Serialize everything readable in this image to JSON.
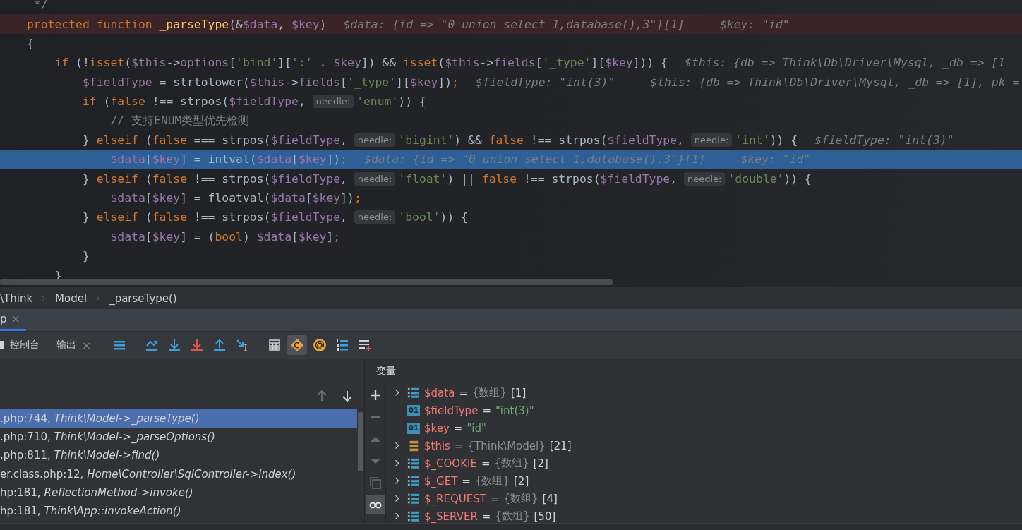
{
  "editor": {
    "lines": [
      {
        "kind": "normal",
        "tokens": [
          {
            "kind": "comment",
            "t": " */"
          }
        ]
      },
      {
        "kind": "breakpoint",
        "tokens": [
          {
            "kind": "kw",
            "t": "protected function "
          },
          {
            "kind": "fn",
            "t": "_parseType"
          },
          {
            "kind": "plain",
            "t": "(&"
          },
          {
            "kind": "var",
            "t": "$data"
          },
          {
            "kind": "plain",
            "t": ", "
          },
          {
            "kind": "var",
            "t": "$key"
          },
          {
            "kind": "plain",
            "t": ")"
          },
          {
            "kind": "inline",
            "t": "$data: {id => \"0 union select 1,database(),3\"}[1]"
          },
          {
            "kind": "inline",
            "t": "$key: \"id\""
          }
        ]
      },
      {
        "kind": "normal",
        "tokens": [
          {
            "kind": "plain",
            "t": "{"
          }
        ]
      },
      {
        "kind": "normal",
        "tokens": [
          {
            "kind": "kw",
            "t": "    if"
          },
          {
            "kind": "plain",
            "t": " (!"
          },
          {
            "kind": "kw",
            "t": "isset"
          },
          {
            "kind": "plain",
            "t": "("
          },
          {
            "kind": "var",
            "t": "$this"
          },
          {
            "kind": "plain",
            "t": "->"
          },
          {
            "kind": "var",
            "t": "options"
          },
          {
            "kind": "plain",
            "t": "["
          },
          {
            "kind": "str",
            "t": "'bind'"
          },
          {
            "kind": "plain",
            "t": "]["
          },
          {
            "kind": "str",
            "t": "':'"
          },
          {
            "kind": "plain",
            "t": " . "
          },
          {
            "kind": "var",
            "t": "$key"
          },
          {
            "kind": "plain",
            "t": "]) && "
          },
          {
            "kind": "kw",
            "t": "isset"
          },
          {
            "kind": "plain",
            "t": "("
          },
          {
            "kind": "var",
            "t": "$this"
          },
          {
            "kind": "plain",
            "t": "->"
          },
          {
            "kind": "var",
            "t": "fields"
          },
          {
            "kind": "plain",
            "t": "["
          },
          {
            "kind": "str",
            "t": "'_type'"
          },
          {
            "kind": "plain",
            "t": "]["
          },
          {
            "kind": "var",
            "t": "$key"
          },
          {
            "kind": "plain",
            "t": "])) {"
          },
          {
            "kind": "inline",
            "t": "$this: {db => Think\\Db\\Driver\\Mysql, _db => [1"
          }
        ]
      },
      {
        "kind": "normal",
        "tokens": [
          {
            "kind": "var",
            "t": "        $fieldType"
          },
          {
            "kind": "plain",
            "t": " = strtolower("
          },
          {
            "kind": "var",
            "t": "$this"
          },
          {
            "kind": "plain",
            "t": "->"
          },
          {
            "kind": "var",
            "t": "fields"
          },
          {
            "kind": "plain",
            "t": "["
          },
          {
            "kind": "str",
            "t": "'_type'"
          },
          {
            "kind": "plain",
            "t": "]["
          },
          {
            "kind": "var",
            "t": "$key"
          },
          {
            "kind": "plain",
            "t": "])"
          },
          {
            "kind": "kw",
            "t": ";"
          },
          {
            "kind": "inline",
            "t": "$fieldType: \"int(3)\""
          },
          {
            "kind": "inline",
            "t": "$this: {db => Think\\Db\\Driver\\Mysql, _db => [1], pk ="
          }
        ]
      },
      {
        "kind": "normal",
        "tokens": [
          {
            "kind": "kw",
            "t": "        if"
          },
          {
            "kind": "plain",
            "t": " ("
          },
          {
            "kind": "kw",
            "t": "false"
          },
          {
            "kind": "plain",
            "t": " !== strpos("
          },
          {
            "kind": "var",
            "t": "$fieldType"
          },
          {
            "kind": "plain",
            "t": ", "
          },
          {
            "kind": "hint",
            "t": "needle:"
          },
          {
            "kind": "str",
            "t": "'enum'"
          },
          {
            "kind": "plain",
            "t": ")) {"
          }
        ]
      },
      {
        "kind": "normal",
        "tokens": [
          {
            "kind": "comment",
            "t": "            // 支持ENUM类型优先检测"
          }
        ]
      },
      {
        "kind": "normal",
        "tokens": [
          {
            "kind": "plain",
            "t": "        } "
          },
          {
            "kind": "kw",
            "t": "elseif"
          },
          {
            "kind": "plain",
            "t": " ("
          },
          {
            "kind": "kw",
            "t": "false"
          },
          {
            "kind": "plain",
            "t": " === strpos("
          },
          {
            "kind": "var",
            "t": "$fieldType"
          },
          {
            "kind": "plain",
            "t": ", "
          },
          {
            "kind": "hint",
            "t": "needle:"
          },
          {
            "kind": "str",
            "t": "'bigint'"
          },
          {
            "kind": "plain",
            "t": ") && "
          },
          {
            "kind": "kw",
            "t": "false"
          },
          {
            "kind": "plain",
            "t": " !== strpos("
          },
          {
            "kind": "var",
            "t": "$fieldType"
          },
          {
            "kind": "plain",
            "t": ", "
          },
          {
            "kind": "hint",
            "t": "needle:"
          },
          {
            "kind": "str",
            "t": "'int'"
          },
          {
            "kind": "plain",
            "t": ")) {"
          },
          {
            "kind": "inline",
            "t": "$fieldType: \"int(3)\""
          }
        ]
      },
      {
        "kind": "current",
        "tokens": [
          {
            "kind": "var",
            "t": "            $data"
          },
          {
            "kind": "plain",
            "t": "["
          },
          {
            "kind": "var",
            "t": "$key"
          },
          {
            "kind": "plain",
            "t": "] = intval("
          },
          {
            "kind": "var",
            "t": "$data"
          },
          {
            "kind": "plain",
            "t": "["
          },
          {
            "kind": "var",
            "t": "$key"
          },
          {
            "kind": "plain",
            "t": "])"
          },
          {
            "kind": "kw",
            "t": ";"
          },
          {
            "kind": "inline",
            "t": "$data: {id => \"0 union select 1,database(),3\"}[1]"
          },
          {
            "kind": "inline",
            "t": "$key: \"id\""
          }
        ]
      },
      {
        "kind": "normal",
        "tokens": [
          {
            "kind": "plain",
            "t": "        } "
          },
          {
            "kind": "kw",
            "t": "elseif"
          },
          {
            "kind": "plain",
            "t": " ("
          },
          {
            "kind": "kw",
            "t": "false"
          },
          {
            "kind": "plain",
            "t": " !== strpos("
          },
          {
            "kind": "var",
            "t": "$fieldType"
          },
          {
            "kind": "plain",
            "t": ", "
          },
          {
            "kind": "hint",
            "t": "needle:"
          },
          {
            "kind": "str",
            "t": "'float'"
          },
          {
            "kind": "plain",
            "t": ") || "
          },
          {
            "kind": "kw",
            "t": "false"
          },
          {
            "kind": "plain",
            "t": " !== strpos("
          },
          {
            "kind": "var",
            "t": "$fieldType"
          },
          {
            "kind": "plain",
            "t": ", "
          },
          {
            "kind": "hint",
            "t": "needle:"
          },
          {
            "kind": "str",
            "t": "'double'"
          },
          {
            "kind": "plain",
            "t": ")) {"
          }
        ]
      },
      {
        "kind": "normal",
        "tokens": [
          {
            "kind": "var",
            "t": "            $data"
          },
          {
            "kind": "plain",
            "t": "["
          },
          {
            "kind": "var",
            "t": "$key"
          },
          {
            "kind": "plain",
            "t": "] = floatval("
          },
          {
            "kind": "var",
            "t": "$data"
          },
          {
            "kind": "plain",
            "t": "["
          },
          {
            "kind": "var",
            "t": "$key"
          },
          {
            "kind": "plain",
            "t": "])"
          },
          {
            "kind": "kw",
            "t": ";"
          }
        ]
      },
      {
        "kind": "normal",
        "tokens": [
          {
            "kind": "plain",
            "t": "        } "
          },
          {
            "kind": "kw",
            "t": "elseif"
          },
          {
            "kind": "plain",
            "t": " ("
          },
          {
            "kind": "kw",
            "t": "false"
          },
          {
            "kind": "plain",
            "t": " !== strpos("
          },
          {
            "kind": "var",
            "t": "$fieldType"
          },
          {
            "kind": "plain",
            "t": ", "
          },
          {
            "kind": "hint",
            "t": "needle:"
          },
          {
            "kind": "str",
            "t": "'bool'"
          },
          {
            "kind": "plain",
            "t": ")) {"
          }
        ]
      },
      {
        "kind": "normal",
        "tokens": [
          {
            "kind": "var",
            "t": "            $data"
          },
          {
            "kind": "plain",
            "t": "["
          },
          {
            "kind": "var",
            "t": "$key"
          },
          {
            "kind": "plain",
            "t": "] = ("
          },
          {
            "kind": "kw",
            "t": "bool"
          },
          {
            "kind": "plain",
            "t": ") "
          },
          {
            "kind": "var",
            "t": "$data"
          },
          {
            "kind": "plain",
            "t": "["
          },
          {
            "kind": "var",
            "t": "$key"
          },
          {
            "kind": "plain",
            "t": "]"
          },
          {
            "kind": "kw",
            "t": ";"
          }
        ]
      },
      {
        "kind": "normal",
        "tokens": [
          {
            "kind": "plain",
            "t": "        }"
          }
        ]
      },
      {
        "kind": "normal",
        "tokens": [
          {
            "kind": "plain",
            "t": "    }"
          }
        ]
      }
    ]
  },
  "breadcrumbs": [
    "\\Think",
    "Model",
    "_parseType()"
  ],
  "tabs": [
    {
      "label": "p",
      "close": "×",
      "selected": true
    }
  ],
  "toolbar": {
    "tabs": [
      {
        "label": "控制台",
        "selected": false
      },
      {
        "label": "输出",
        "close": "×",
        "selected": false
      }
    ],
    "tools": [
      {
        "kind": "frames",
        "on": false
      },
      {
        "kind": "step-over",
        "on": false
      },
      {
        "kind": "step-into",
        "on": false
      },
      {
        "kind": "force-step-into",
        "on": false
      },
      {
        "kind": "step-out",
        "on": false
      },
      {
        "kind": "run-to-cursor",
        "on": false
      },
      {
        "kind": "evaluate",
        "on": false
      },
      {
        "kind": "class-filter",
        "on": true
      },
      {
        "kind": "watch",
        "on": false
      },
      {
        "kind": "numbered",
        "on": false
      },
      {
        "kind": "add-list",
        "on": false
      }
    ]
  },
  "frames": {
    "nav": [
      {
        "kind": "up",
        "disabled": true
      },
      {
        "kind": "down",
        "disabled": false
      }
    ],
    "items": [
      {
        "location": ".php:744,",
        "method": "Think\\Model->_parseType()",
        "selected": true
      },
      {
        "location": ".php:710,",
        "method": "Think\\Model->_parseOptions()",
        "selected": false
      },
      {
        "location": ".php:811,",
        "method": "Think\\Model->find()",
        "selected": false
      },
      {
        "location": "er.class.php:12,",
        "method": "Home\\Controller\\SqlController->index()",
        "selected": false
      },
      {
        "location": "hp:181,",
        "method": "ReflectionMethod->invoke()",
        "selected": false
      },
      {
        "location": "hp:181,",
        "method": "Think\\App::invokeAction()",
        "selected": false
      }
    ]
  },
  "variables": {
    "title": "变量",
    "tools": [
      {
        "kind": "plus",
        "disabled": false,
        "on": false
      },
      {
        "kind": "minus",
        "disabled": true,
        "on": false
      },
      {
        "kind": "up",
        "disabled": true,
        "on": false
      },
      {
        "kind": "down",
        "disabled": true,
        "on": false
      },
      {
        "kind": "copy",
        "disabled": true,
        "on": false
      },
      {
        "kind": "glasses",
        "disabled": false,
        "on": true
      }
    ],
    "items": [
      {
        "kind": "array",
        "name": "$data",
        "sign": "=",
        "type": "{数组}",
        "value": "[1]"
      },
      {
        "kind": "string",
        "badge": "01",
        "name": "$fieldType",
        "sign": "=",
        "value": "\"int(3)\""
      },
      {
        "kind": "string",
        "badge": "01",
        "name": "$key",
        "sign": "=",
        "value": "\"id\""
      },
      {
        "kind": "object",
        "name": "$this",
        "sign": "=",
        "type": "{Think\\Model}",
        "value": "[21]"
      },
      {
        "kind": "array",
        "name": "$_COOKIE",
        "sign": "=",
        "type": "{数组}",
        "value": "[2]"
      },
      {
        "kind": "array",
        "name": "$_GET",
        "sign": "=",
        "type": "{数组}",
        "value": "[2]"
      },
      {
        "kind": "array",
        "name": "$_REQUEST",
        "sign": "=",
        "type": "{数组}",
        "value": "[4]"
      },
      {
        "kind": "array",
        "name": "$_SERVER",
        "sign": "=",
        "type": "{数组}",
        "value": "[50]"
      }
    ]
  }
}
